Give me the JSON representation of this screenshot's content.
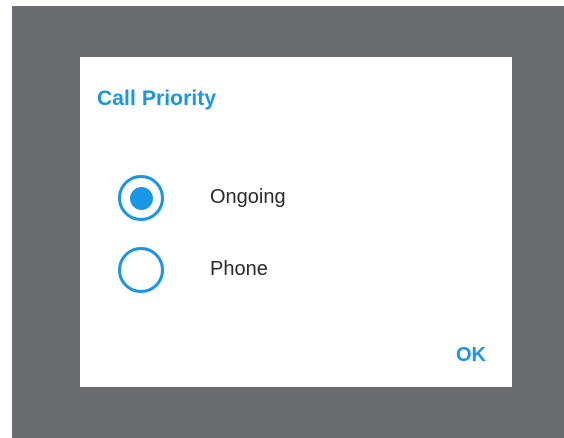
{
  "dialog": {
    "title": "Call Priority",
    "options": [
      {
        "label": "Ongoing",
        "selected": true
      },
      {
        "label": "Phone",
        "selected": false
      }
    ],
    "ok_label": "OK"
  },
  "colors": {
    "accent": "#1a96e6",
    "backdrop": "#6b6c70",
    "surface": "#ffffff",
    "text": "#2b2b2b"
  },
  "icons": {
    "selected_radio": "radio-checked-icon",
    "unselected_radio": "radio-unchecked-icon"
  }
}
